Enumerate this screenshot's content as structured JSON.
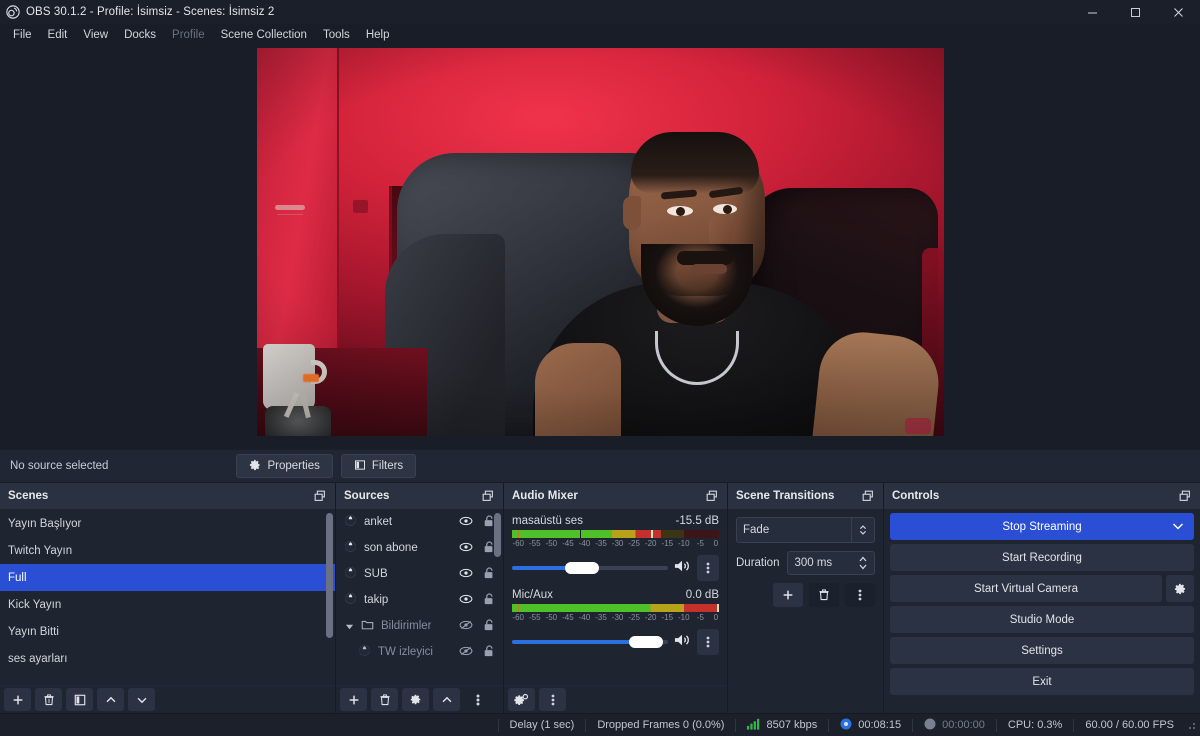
{
  "window": {
    "title": "OBS 30.1.2 - Profile: İsimsiz - Scenes: İsimsiz 2",
    "app_icon": "obs-logo-icon",
    "minimize": "minimize-icon",
    "maximize": "maximize-icon",
    "close": "close-icon"
  },
  "menu": {
    "items": [
      {
        "label": "File",
        "disabled": false
      },
      {
        "label": "Edit",
        "disabled": false
      },
      {
        "label": "View",
        "disabled": false
      },
      {
        "label": "Docks",
        "disabled": false
      },
      {
        "label": "Profile",
        "disabled": true
      },
      {
        "label": "Scene Collection",
        "disabled": false
      },
      {
        "label": "Tools",
        "disabled": false
      },
      {
        "label": "Help",
        "disabled": false
      }
    ]
  },
  "preview": {
    "description": "Live webcam preview: man seated in gaming chair, red-lit room"
  },
  "source_toolbar": {
    "status": "No source selected",
    "properties_label": "Properties",
    "filters_label": "Filters"
  },
  "scenes": {
    "title": "Scenes",
    "items": [
      {
        "label": "Yayın Başlıyor",
        "selected": false
      },
      {
        "label": "Twitch Yayın",
        "selected": false
      },
      {
        "label": "Full",
        "selected": true
      },
      {
        "label": "Kick Yayın",
        "selected": false
      },
      {
        "label": "Yayın Bitti",
        "selected": false
      },
      {
        "label": "ses ayarları",
        "selected": false
      }
    ],
    "toolbar": [
      "add-scene-icon",
      "remove-scene-icon",
      "scene-filters-icon",
      "move-scene-up-icon",
      "move-scene-down-icon"
    ]
  },
  "sources": {
    "title": "Sources",
    "items": [
      {
        "label": "anket",
        "icon": "browser-source-icon",
        "visible": true,
        "locked": false,
        "indent": false,
        "group": false
      },
      {
        "label": "son abone",
        "icon": "browser-source-icon",
        "visible": true,
        "locked": false,
        "indent": false,
        "group": false
      },
      {
        "label": "SUB",
        "icon": "browser-source-icon",
        "visible": true,
        "locked": false,
        "indent": false,
        "group": false
      },
      {
        "label": "takip",
        "icon": "browser-source-icon",
        "visible": true,
        "locked": false,
        "indent": false,
        "group": false
      },
      {
        "label": "Bildirimler",
        "icon": "group-folder-icon",
        "visible": false,
        "locked": false,
        "indent": false,
        "group": true
      },
      {
        "label": "TW izleyici",
        "icon": "browser-source-icon",
        "visible": false,
        "locked": false,
        "indent": true,
        "group": false
      }
    ],
    "toolbar": [
      "add-source-icon",
      "remove-source-icon",
      "source-properties-icon",
      "move-source-up-icon",
      "source-more-icon"
    ]
  },
  "mixer": {
    "title": "Audio Mixer",
    "scale_ticks": [
      "-60",
      "-55",
      "-50",
      "-45",
      "-40",
      "-35",
      "-30",
      "-25",
      "-20",
      "-15",
      "-10",
      "-5",
      "0"
    ],
    "tracks": [
      {
        "name": "masaüstü ses",
        "level": "-15.5 dB",
        "meter_pct": 72,
        "peak_pct": 67,
        "fader_pct": 45,
        "muted": false
      },
      {
        "name": "Mic/Aux",
        "level": "0.0 dB",
        "meter_pct": 100,
        "peak_pct": 100,
        "fader_pct": 88,
        "muted": false
      }
    ],
    "toolbar": [
      "advanced-audio-properties-icon",
      "mixer-more-icon"
    ]
  },
  "transitions": {
    "title": "Scene Transitions",
    "selected": "Fade",
    "duration_label": "Duration",
    "duration_value": "300 ms",
    "toolbar": [
      "add-transition-icon",
      "remove-transition-icon",
      "transition-more-icon"
    ]
  },
  "controls": {
    "title": "Controls",
    "buttons": [
      {
        "label": "Stop Streaming",
        "primary": true,
        "chevron": true
      },
      {
        "label": "Start Recording",
        "primary": false,
        "chevron": false
      },
      {
        "label": "Start Virtual Camera",
        "primary": false,
        "chevron": false,
        "gear": true
      },
      {
        "label": "Studio Mode",
        "primary": false,
        "chevron": false
      },
      {
        "label": "Settings",
        "primary": false,
        "chevron": false
      },
      {
        "label": "Exit",
        "primary": false,
        "chevron": false
      }
    ]
  },
  "status": {
    "delay": "Delay (1 sec)",
    "dropped": "Dropped Frames 0 (0.0%)",
    "bitrate": "8507 kbps",
    "stream_time": "00:08:15",
    "record_time": "00:00:00",
    "cpu": "CPU: 0.3%",
    "fps": "60.00 / 60.00 FPS"
  },
  "colors": {
    "accent": "#2a4ed4",
    "dock_bg": "#1e2430",
    "dock_head": "#2a3140",
    "window_bg": "#181d27",
    "meter_green": "#4fbf2a",
    "meter_yellow": "#b7a219",
    "meter_red": "#c4302c",
    "signal_green": "#39b54a"
  }
}
